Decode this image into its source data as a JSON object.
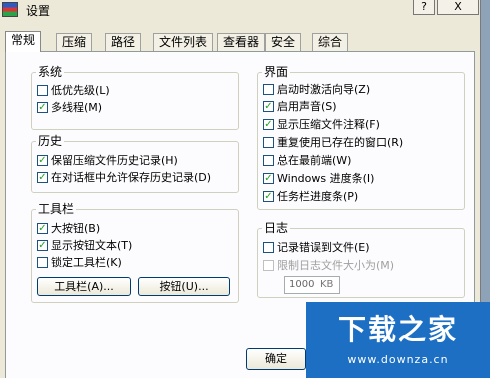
{
  "window": {
    "title": "设置",
    "help_label": "?",
    "close_label": "X"
  },
  "tabs": [
    {
      "label": "常规",
      "active": true
    },
    {
      "label": "压缩"
    },
    {
      "label": "路径"
    },
    {
      "label": "文件列表"
    },
    {
      "label": "查看器"
    },
    {
      "label": "安全"
    },
    {
      "label": "综合"
    }
  ],
  "groups": {
    "system": {
      "title": "系统",
      "items": [
        {
          "label": "低优先级(L)",
          "checked": false
        },
        {
          "label": "多线程(M)",
          "checked": true
        }
      ]
    },
    "history": {
      "title": "历史",
      "items": [
        {
          "label": "保留压缩文件历史记录(H)",
          "checked": true
        },
        {
          "label": "在对话框中允许保存历史记录(D)",
          "checked": true
        }
      ]
    },
    "toolbar": {
      "title": "工具栏",
      "items": [
        {
          "label": "大按钮(B)",
          "checked": true
        },
        {
          "label": "显示按钮文本(T)",
          "checked": true
        },
        {
          "label": "锁定工具栏(K)",
          "checked": false
        }
      ],
      "buttons": {
        "toolbar_btn": "工具栏(A)...",
        "buttons_btn": "按钮(U)..."
      }
    },
    "interface": {
      "title": "界面",
      "items": [
        {
          "label": "启动时激活向导(Z)",
          "checked": false
        },
        {
          "label": "启用声音(S)",
          "checked": true
        },
        {
          "label": "显示压缩文件注释(F)",
          "checked": true
        },
        {
          "label": "重复使用已存在的窗口(R)",
          "checked": false
        },
        {
          "label": "总在最前端(W)",
          "checked": false
        },
        {
          "label": "Windows 进度条(I)",
          "checked": true
        },
        {
          "label": "任务栏进度条(P)",
          "checked": true
        }
      ]
    },
    "log": {
      "title": "日志",
      "items": [
        {
          "label": "记录错误到文件(E)",
          "checked": false
        },
        {
          "label": "限制日志文件大小为(M)",
          "checked": false,
          "disabled": true
        }
      ],
      "size_value": "1000",
      "size_unit": "KB"
    }
  },
  "footer": {
    "ok_label": "确定"
  },
  "watermark": {
    "title": "下载之家",
    "url": "www.downza.cn",
    "color": "#1d6fc4"
  }
}
